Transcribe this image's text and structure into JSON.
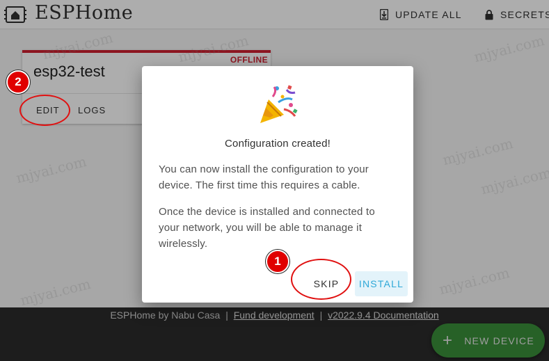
{
  "app": {
    "title": "ESPHome",
    "logo_icon": "esphome-logo-icon"
  },
  "header": {
    "update_all_label": "UPDATE ALL",
    "update_all_icon": "download-icon",
    "secrets_label": "SECRETS",
    "secrets_icon": "lock-icon"
  },
  "device_card": {
    "name": "esp32-test",
    "status": "OFFLINE",
    "status_color": "#cf2030",
    "edit_label": "EDIT",
    "logs_label": "LOGS"
  },
  "dialog": {
    "icon": "party-popper-icon",
    "title": "Configuration created!",
    "text_1": "You can now install the configuration to your device. The first time this requires a cable.",
    "text_2": "Once the device is installed and connected to your network, you will be able to manage it wirelessly.",
    "skip_label": "SKIP",
    "install_label": "INSTALL",
    "install_color": "#2ea8d8"
  },
  "footer": {
    "credit": "ESPHome by Nabu Casa",
    "separator": "|",
    "fund_link": "Fund development",
    "docs_link": "v2022.9.4 Documentation"
  },
  "fab": {
    "label": "NEW DEVICE",
    "icon": "plus-icon",
    "color": "#3a8f3a"
  },
  "annotations": {
    "marker_1": "1",
    "marker_2": "2"
  },
  "watermark": "mjyai.com"
}
